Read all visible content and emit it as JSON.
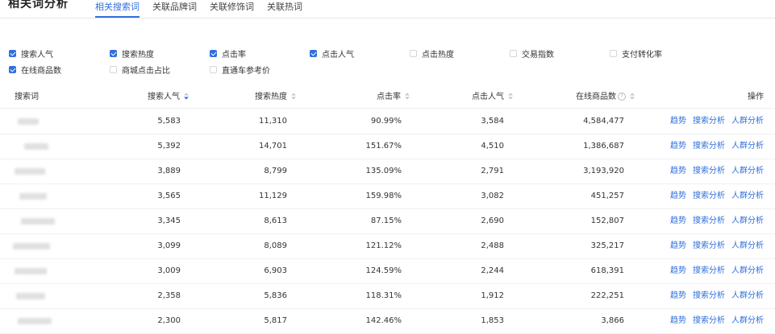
{
  "header": {
    "title": "相关词分析",
    "tabs": [
      {
        "label": "相关搜索词",
        "active": true
      },
      {
        "label": "关联品牌词",
        "active": false
      },
      {
        "label": "关联修饰词",
        "active": false
      },
      {
        "label": "关联热词",
        "active": false
      }
    ]
  },
  "metrics": [
    {
      "label": "搜索人气",
      "checked": true
    },
    {
      "label": "搜索热度",
      "checked": true
    },
    {
      "label": "点击率",
      "checked": true
    },
    {
      "label": "点击人气",
      "checked": true
    },
    {
      "label": "点击热度",
      "checked": false
    },
    {
      "label": "交易指数",
      "checked": false
    },
    {
      "label": "支付转化率",
      "checked": false
    },
    {
      "label": "在线商品数",
      "checked": true
    },
    {
      "label": "商城点击占比",
      "checked": false
    },
    {
      "label": "直通车参考价",
      "checked": false
    }
  ],
  "table": {
    "columns": {
      "term": "搜索词",
      "search_popularity": "搜索人气",
      "search_heat": "搜索热度",
      "ctr": "点击率",
      "click_popularity": "点击人气",
      "online_items": "在线商品数",
      "actions": "操作"
    },
    "action_labels": {
      "trend": "趋势",
      "search_analysis": "搜索分析",
      "crowd_analysis": "人群分析"
    },
    "rows": [
      {
        "search_popularity": "5,583",
        "search_heat": "11,310",
        "ctr": "90.99%",
        "click_popularity": "3,584",
        "online_items": "4,584,477"
      },
      {
        "search_popularity": "5,392",
        "search_heat": "14,701",
        "ctr": "151.67%",
        "click_popularity": "4,510",
        "online_items": "1,386,687"
      },
      {
        "search_popularity": "3,889",
        "search_heat": "8,799",
        "ctr": "135.09%",
        "click_popularity": "2,791",
        "online_items": "3,193,920"
      },
      {
        "search_popularity": "3,565",
        "search_heat": "11,129",
        "ctr": "159.98%",
        "click_popularity": "3,082",
        "online_items": "451,257"
      },
      {
        "search_popularity": "3,345",
        "search_heat": "8,613",
        "ctr": "87.15%",
        "click_popularity": "2,690",
        "online_items": "152,807"
      },
      {
        "search_popularity": "3,099",
        "search_heat": "8,089",
        "ctr": "121.12%",
        "click_popularity": "2,488",
        "online_items": "325,217"
      },
      {
        "search_popularity": "3,009",
        "search_heat": "6,903",
        "ctr": "124.59%",
        "click_popularity": "2,244",
        "online_items": "618,391"
      },
      {
        "search_popularity": "2,358",
        "search_heat": "5,836",
        "ctr": "118.31%",
        "click_popularity": "1,912",
        "online_items": "222,251"
      },
      {
        "search_popularity": "2,300",
        "search_heat": "5,817",
        "ctr": "142.46%",
        "click_popularity": "1,853",
        "online_items": "3,866"
      }
    ]
  },
  "colors": {
    "accent": "#2f6fde"
  }
}
